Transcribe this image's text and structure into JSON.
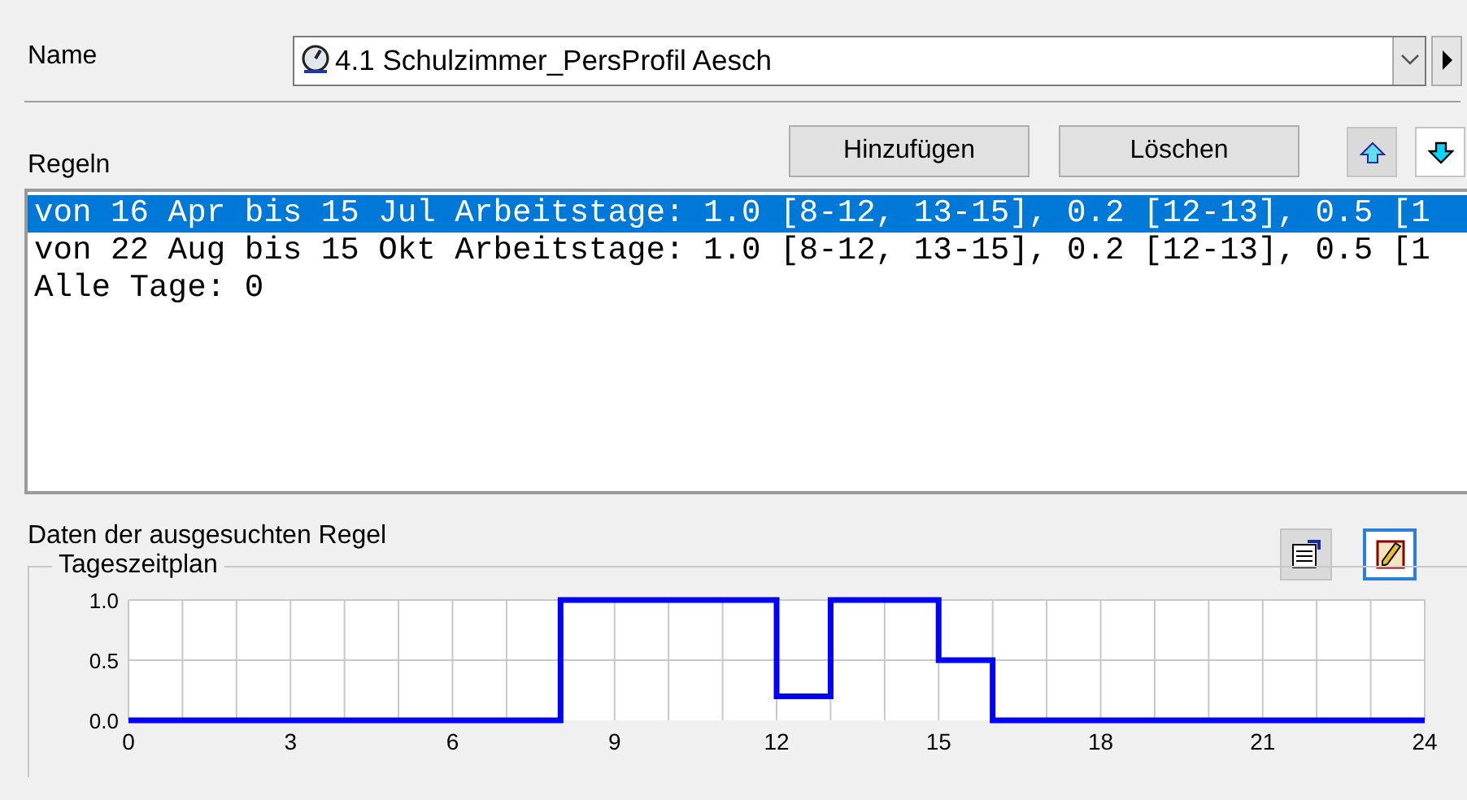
{
  "name_field": {
    "label": "Name",
    "value": "4.1 Schulzimmer_PersProfil Aesch"
  },
  "rules": {
    "label": "Regeln",
    "buttons": [
      "Hinzufügen",
      "Löschen"
    ],
    "items": [
      {
        "text": "von 16 Apr bis 15 Jul Arbeitstage: 1.0 [8-12, 13-15], 0.2 [12-13], 0.5 [1",
        "selected": true
      },
      {
        "text": "von 22 Aug bis 15 Okt Arbeitstage: 1.0 [8-12, 13-15], 0.2 [12-13], 0.5 [1",
        "selected": false
      },
      {
        "text": "Alle Tage: 0",
        "selected": false
      }
    ]
  },
  "details": {
    "label": "Daten der ausgesuchten Regel",
    "group_title": "Tageszeitplan",
    "chart_data": {
      "type": "line",
      "x": [
        0,
        8,
        8,
        12,
        12,
        13,
        13,
        15,
        15,
        16,
        16,
        24
      ],
      "grid": true,
      "series": [
        {
          "color": "#0000ff",
          "values": [
            0,
            0,
            1,
            1,
            0.2,
            0.2,
            1,
            1,
            0.5,
            0.5,
            0,
            0
          ]
        }
      ],
      "xlim": [
        0,
        24
      ],
      "ylim": [
        0,
        1
      ],
      "xticks": [
        0,
        3,
        6,
        9,
        12,
        15,
        18,
        21,
        24
      ],
      "yticks": [
        {
          "value": 0,
          "label": "0.0"
        },
        {
          "value": 0.5,
          "label": "0.5"
        },
        {
          "value": 1,
          "label": "1.0"
        }
      ]
    }
  }
}
